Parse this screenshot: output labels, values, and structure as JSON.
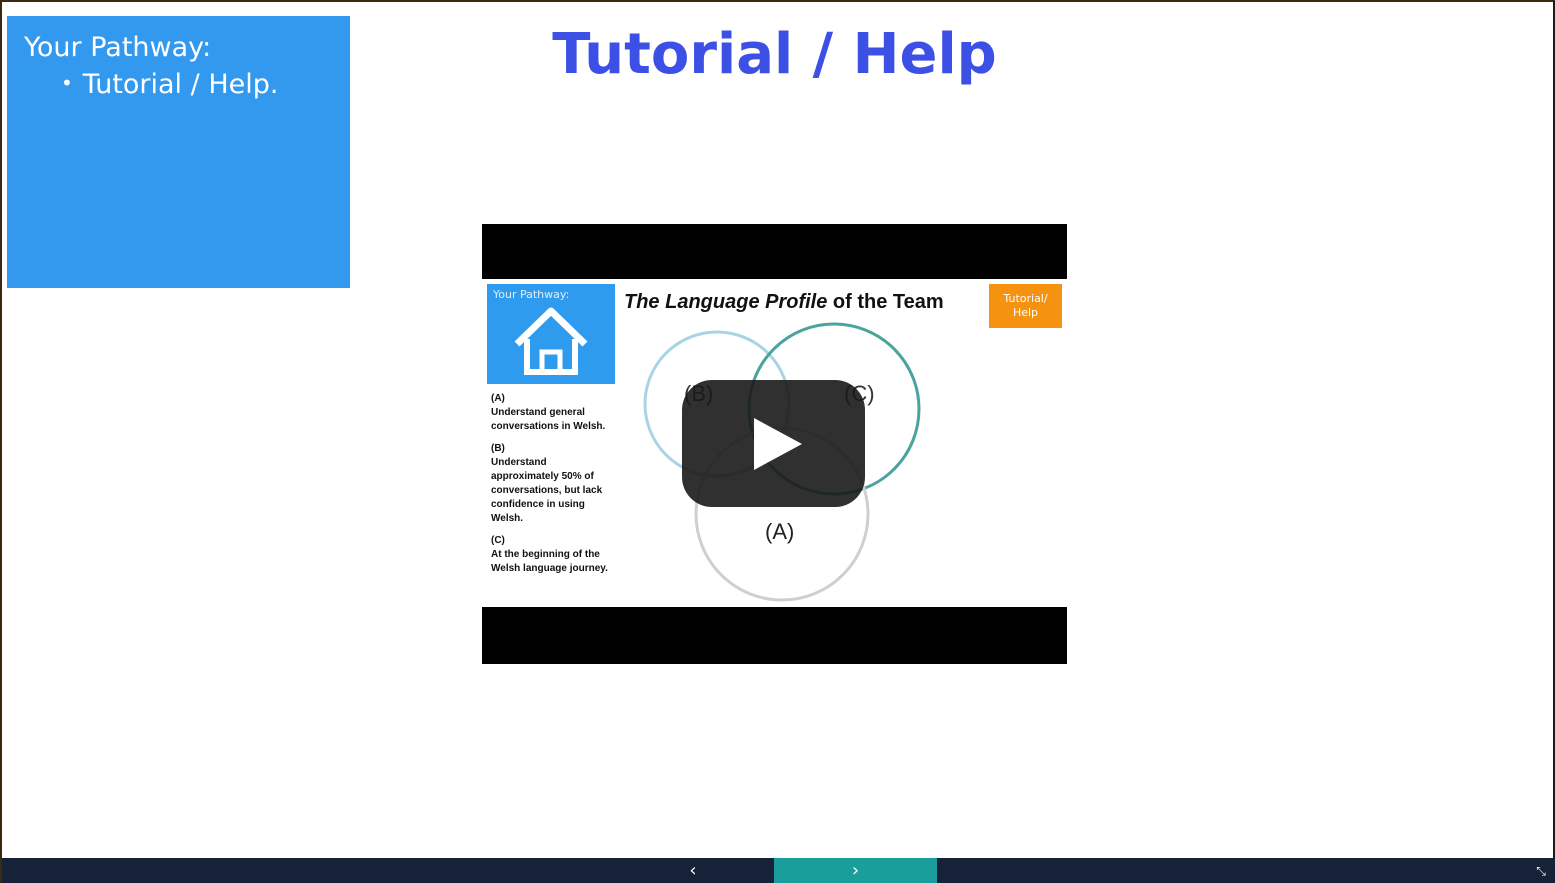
{
  "pathway": {
    "title": "Your Pathway:",
    "items": [
      "Tutorial / Help."
    ]
  },
  "page_title": "Tutorial / Help",
  "video": {
    "thumbnail": {
      "pathway_label": "Your Pathway:",
      "title_italic": "The Language Profile",
      "title_rest": " of the Team",
      "tutorial_label_1": "Tutorial/",
      "tutorial_label_2": "Help",
      "groups": [
        {
          "letter": "(A)",
          "text": "Understand general conversations in Welsh."
        },
        {
          "letter": "(B)",
          "text": "Understand approximately 50% of conversations, but lack confidence in using Welsh."
        },
        {
          "letter": "(C)",
          "text": "At the beginning of the Welsh language journey."
        }
      ],
      "venn_labels": [
        "(B)",
        "(C)",
        "(A)"
      ]
    }
  },
  "nav": {
    "prev_symbol": "‹",
    "next_symbol": "›",
    "fullscreen_symbol": "⤡"
  },
  "colors": {
    "pathway_blue": "#3399ee",
    "title_blue": "#3d50e6",
    "bar_navy": "#152238",
    "next_teal": "#1a9e9b",
    "tutorial_orange": "#f5920f"
  }
}
